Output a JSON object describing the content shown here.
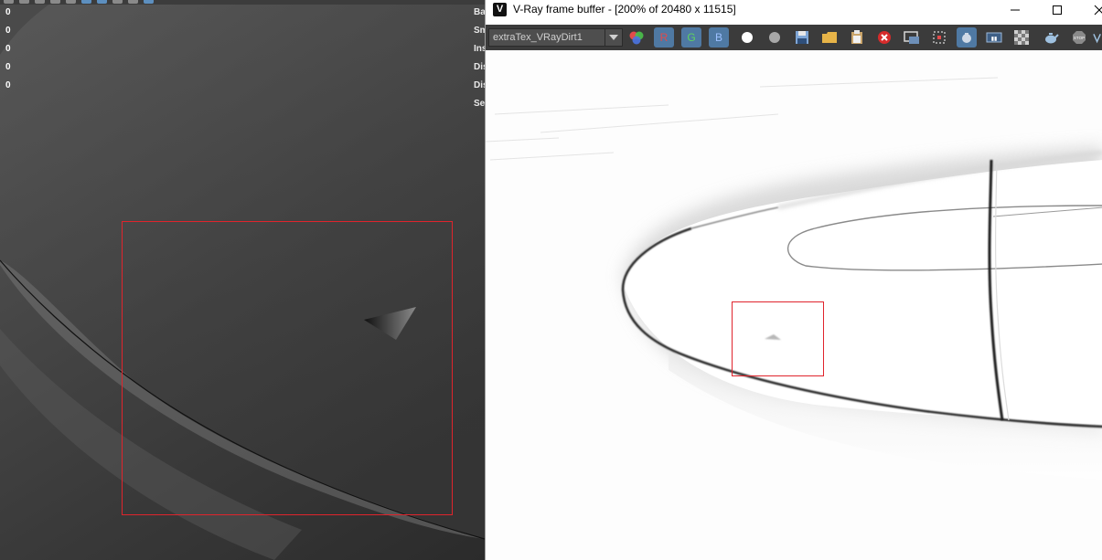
{
  "viewport": {
    "hud_values": [
      "0",
      "0",
      "0",
      "0",
      "0"
    ],
    "hud_labels": [
      "Ba",
      "Sm",
      "Ins",
      "Dis",
      "Dis",
      "Se"
    ],
    "toolbar_icons": [
      "shelf-icon",
      "camera-icon",
      "grid-icon",
      "wireframe-icon",
      "shaded-icon",
      "texture-icon",
      "light-icon",
      "isolate-icon"
    ]
  },
  "vfb": {
    "title": "V-Ray frame buffer - [200% of 20480 x 11515]",
    "logo": "V",
    "channel": "extraTex_VRayDirt1",
    "buttons": {
      "r": "R",
      "g": "G",
      "b": "B"
    },
    "window_controls": [
      "minimize-icon",
      "maximize-icon",
      "close-icon"
    ]
  },
  "colors": {
    "selection_box": "#e0242c",
    "rgb_button": "#4f79a3",
    "toolbar_bg": "#3b3b3b"
  }
}
